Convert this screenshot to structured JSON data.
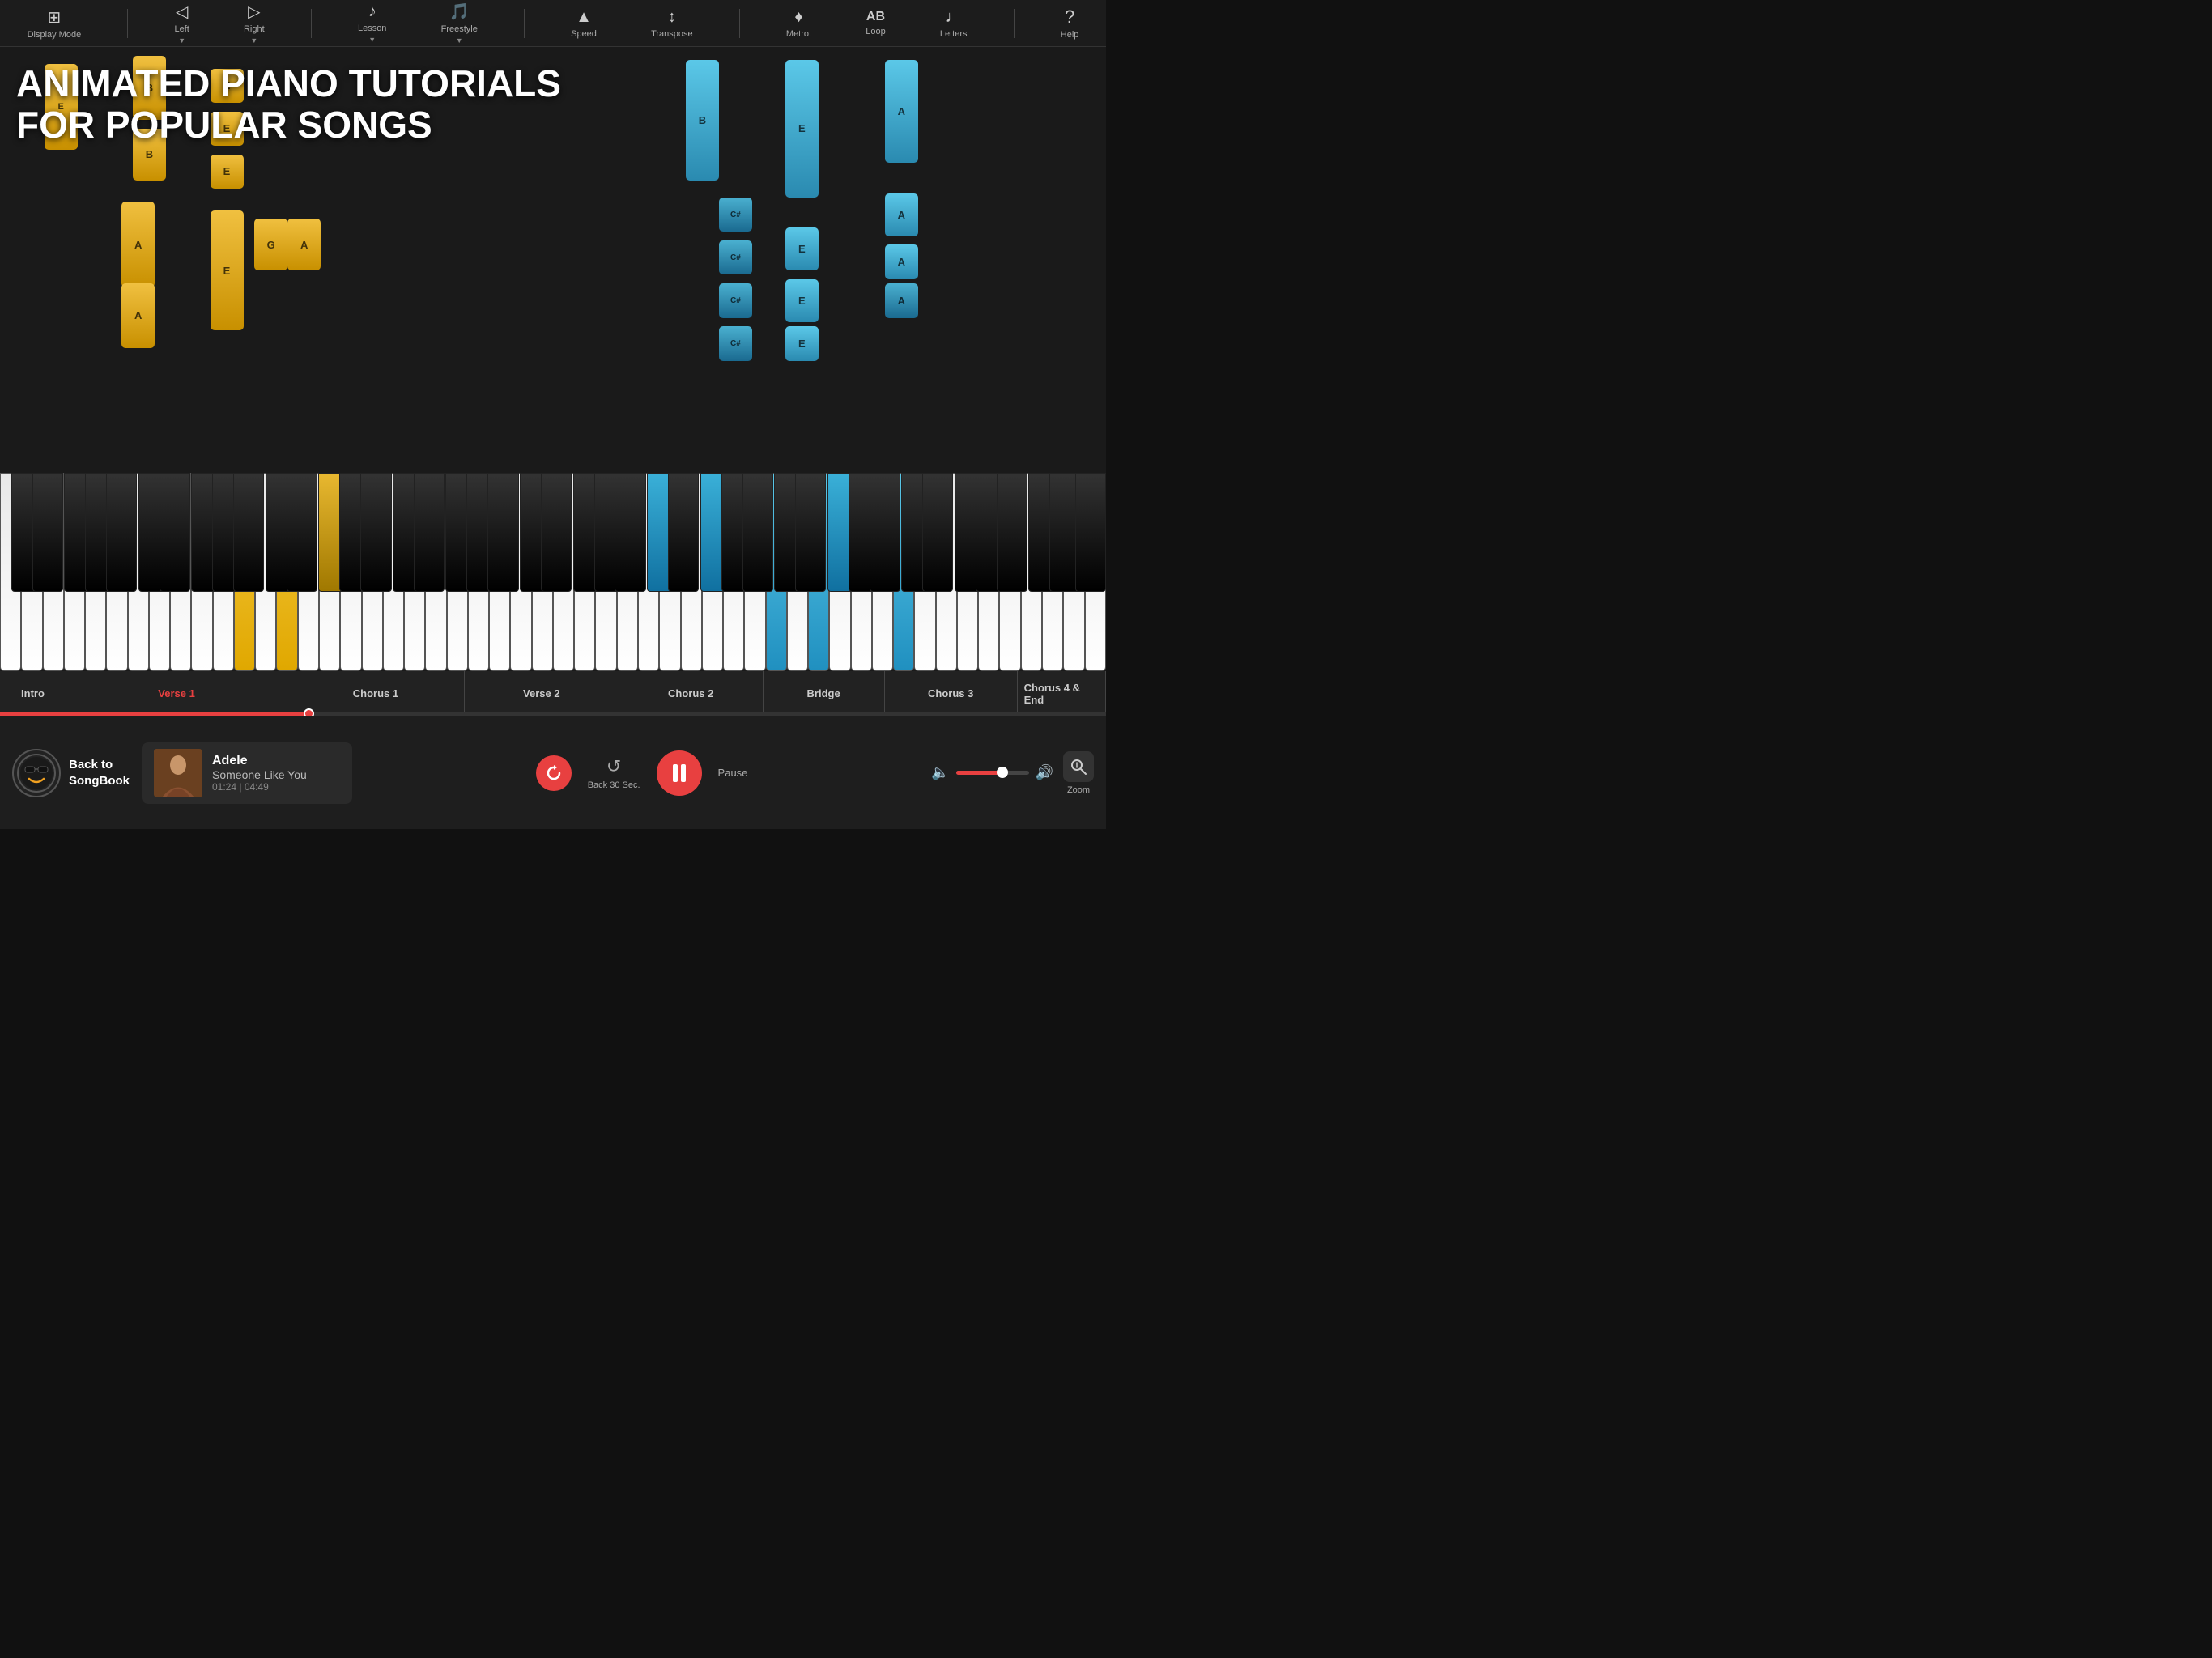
{
  "topBar": {
    "items": [
      {
        "id": "display-mode",
        "label": "Display Mode",
        "icon": "⊞",
        "hasDropdown": false
      },
      {
        "id": "left",
        "label": "Left",
        "icon": "◁",
        "hasDropdown": true
      },
      {
        "id": "right",
        "label": "Right",
        "icon": "▷",
        "hasDropdown": true
      },
      {
        "id": "lesson",
        "label": "Lesson",
        "icon": "♪",
        "hasDropdown": true
      },
      {
        "id": "freestyle",
        "label": "Freestyle",
        "icon": "🎵",
        "hasDropdown": true
      },
      {
        "id": "speed",
        "label": "Speed",
        "icon": "▲",
        "hasDropdown": false
      },
      {
        "id": "transpose",
        "label": "Transpose",
        "icon": "↕",
        "hasDropdown": false
      },
      {
        "id": "metro",
        "label": "Metro.",
        "icon": "♦",
        "hasDropdown": false
      },
      {
        "id": "loop",
        "label": "Loop",
        "icon": "AB",
        "hasDropdown": false
      },
      {
        "id": "letters",
        "label": "Letters",
        "icon": "♩",
        "hasDropdown": false
      },
      {
        "id": "help",
        "label": "Help",
        "icon": "?",
        "hasDropdown": false
      }
    ]
  },
  "watermark": {
    "line1": "ANIMATED PIANO TUTORIALS",
    "line2": "FOR POPULAR SONGS"
  },
  "progressBar": {
    "segments": [
      {
        "id": "intro",
        "label": "Intro",
        "widthPercent": 6,
        "active": false,
        "current": false
      },
      {
        "id": "verse1",
        "label": "Verse 1",
        "widthPercent": 20,
        "active": true,
        "current": true
      },
      {
        "id": "chorus1",
        "label": "Chorus 1",
        "widthPercent": 16,
        "active": false,
        "current": false
      },
      {
        "id": "verse2",
        "label": "Verse 2",
        "widthPercent": 14,
        "active": false,
        "current": false
      },
      {
        "id": "chorus2",
        "label": "Chorus 2",
        "widthPercent": 13,
        "active": false,
        "current": false
      },
      {
        "id": "bridge",
        "label": "Bridge",
        "widthPercent": 11,
        "active": false,
        "current": false
      },
      {
        "id": "chorus3",
        "label": "Chorus 3",
        "widthPercent": 12,
        "active": false,
        "current": false
      },
      {
        "id": "chorus4end",
        "label": "Chorus 4 & End",
        "widthPercent": 8,
        "active": false,
        "current": false
      }
    ],
    "fillPercent": 28
  },
  "bottomControls": {
    "backBtn": {
      "label": "Back to\nSongBook"
    },
    "song": {
      "artist": "Adele",
      "title": "Someone Like You",
      "time": "01:24 | 04:49"
    },
    "controls": {
      "resetLabel": "",
      "back30Label": "Back 30 Sec.",
      "pauseLabel": "Pause"
    },
    "volume": {
      "fillPercent": 65
    },
    "zoom": {
      "label": "Zoom"
    }
  }
}
